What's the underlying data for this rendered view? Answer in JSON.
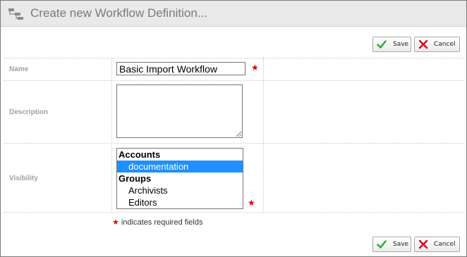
{
  "window": {
    "title": "Create new Workflow Definition..."
  },
  "toolbar": {
    "save_label": "Save",
    "cancel_label": "Cancel"
  },
  "form": {
    "name": {
      "label": "Name",
      "value": "Basic Import Workflow"
    },
    "description": {
      "label": "Description",
      "value": ""
    },
    "visibility": {
      "label": "Visibility",
      "groups": [
        {
          "label": "Accounts",
          "options": [
            {
              "label": "documentation",
              "selected": true
            }
          ]
        },
        {
          "label": "Groups",
          "options": [
            {
              "label": "Archivists",
              "selected": false
            },
            {
              "label": "Editors",
              "selected": false
            }
          ]
        }
      ]
    },
    "required_marker": "★",
    "required_note": "indicates required fields"
  },
  "colors": {
    "required": "#e00000",
    "selected_option": "#1e90ff",
    "save_check": "#2fa82f",
    "cancel_x": "#d9001b"
  },
  "icons": {
    "title": "workflow-icon",
    "save": "checkmark-icon",
    "cancel": "x-icon"
  }
}
